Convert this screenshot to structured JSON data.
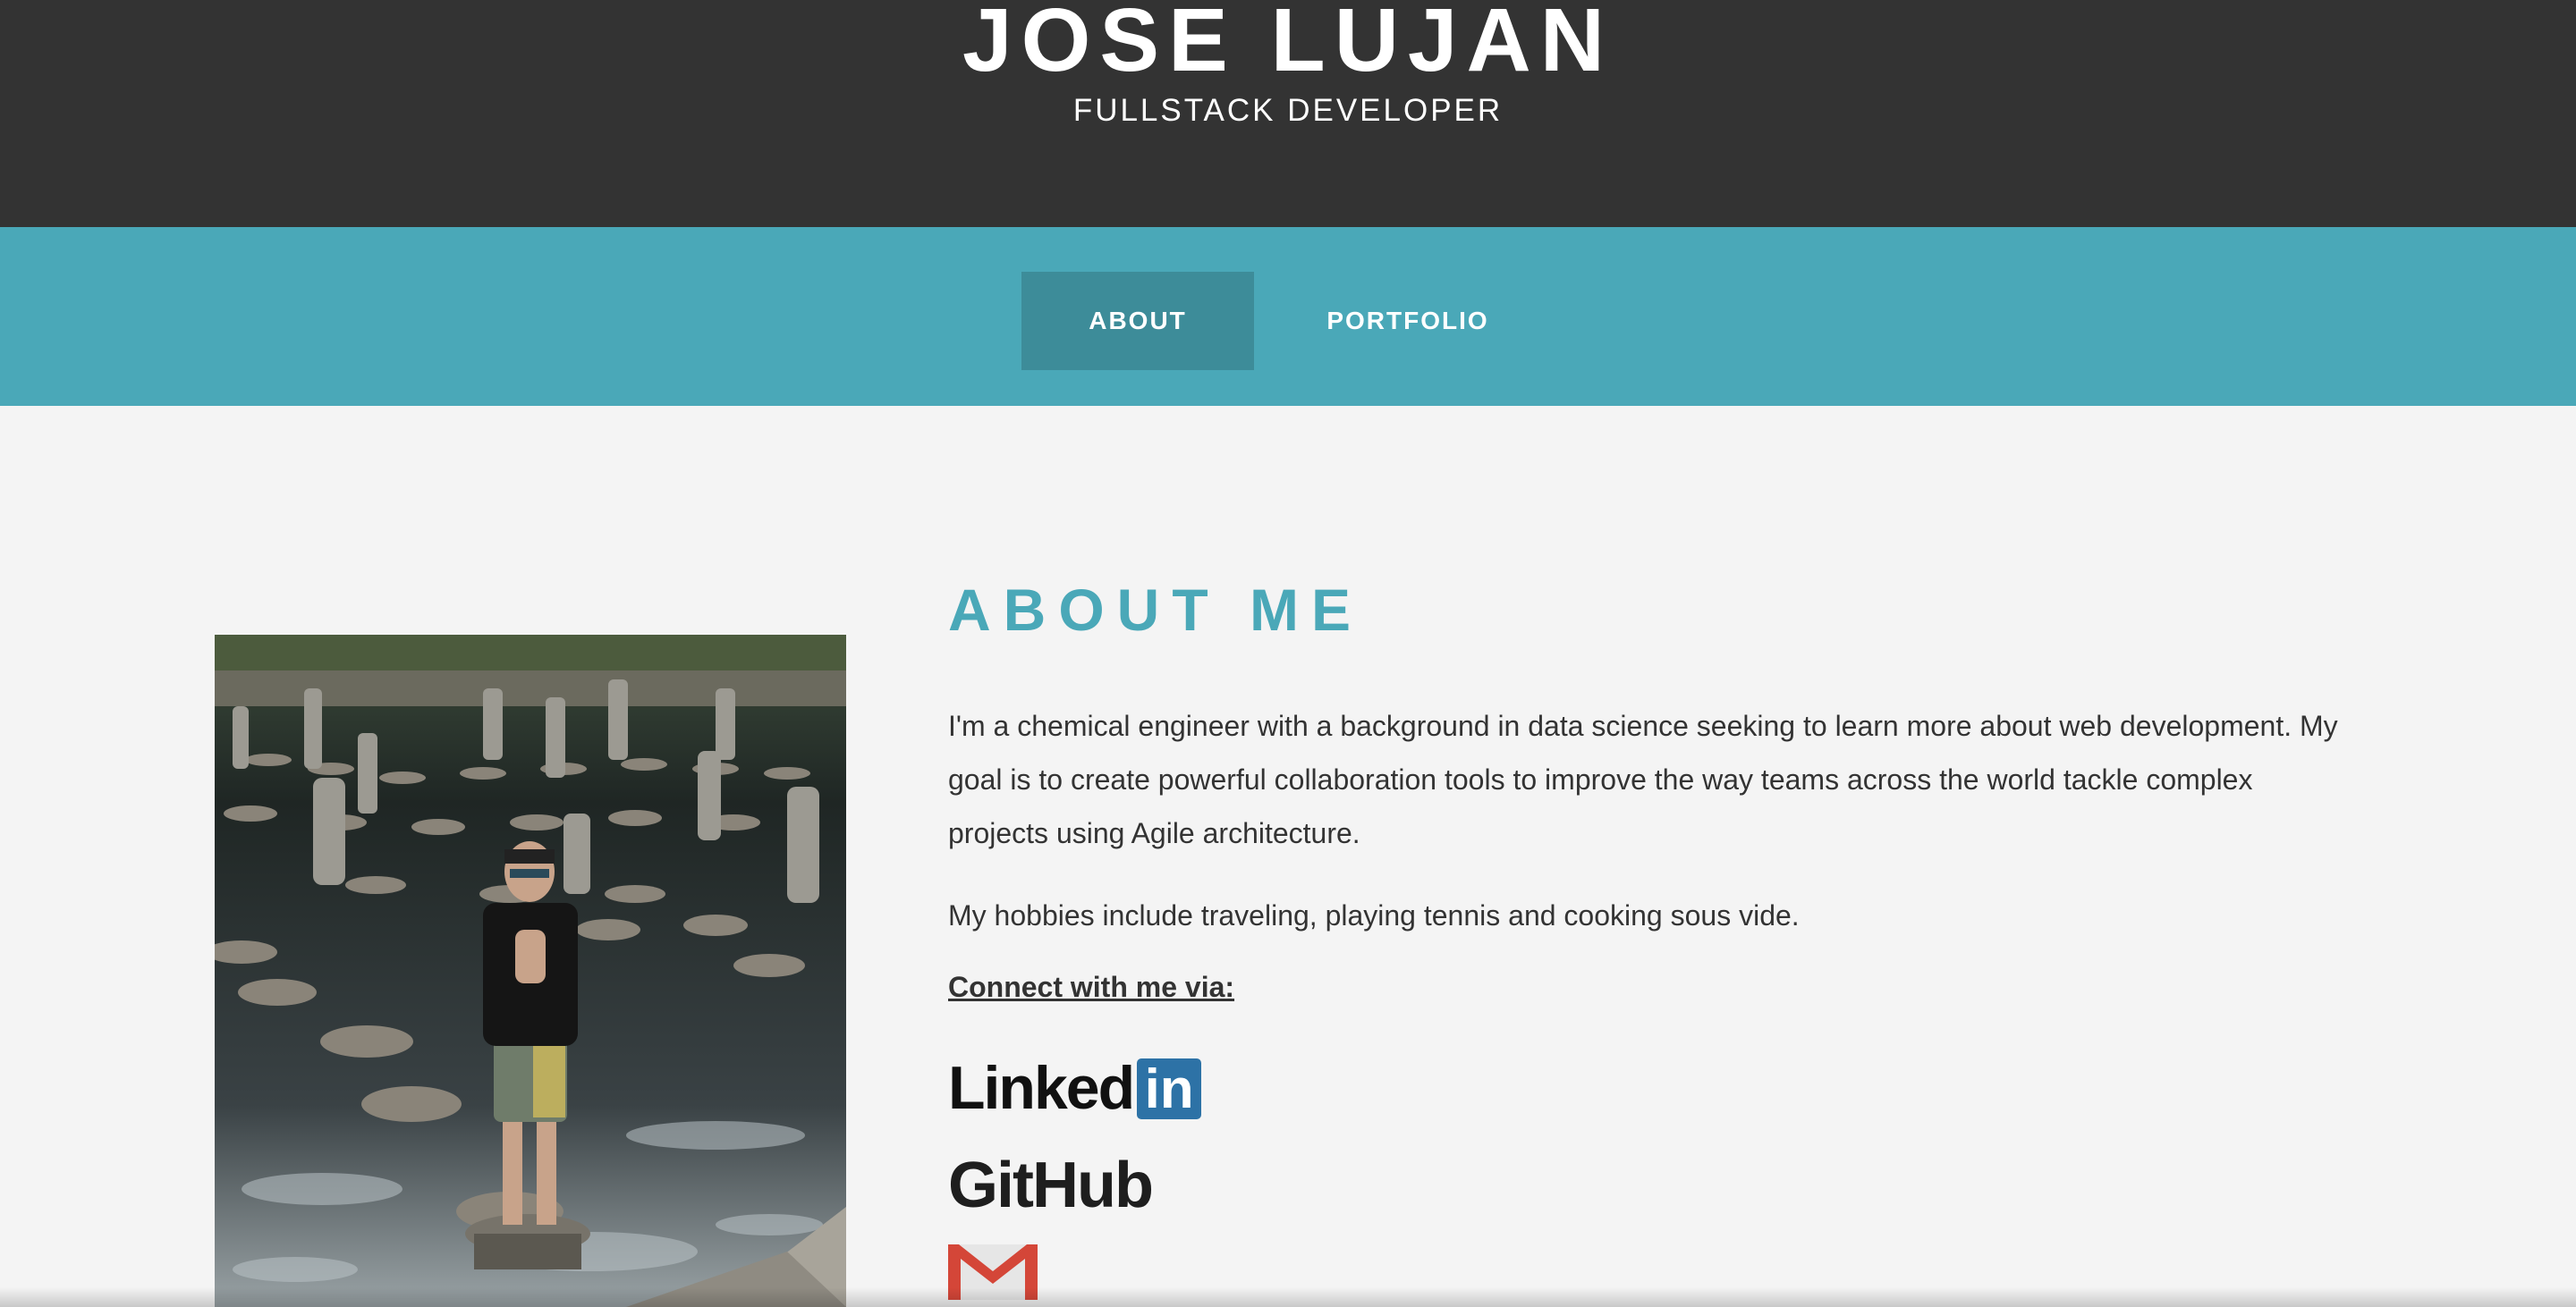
{
  "header": {
    "title": "JOSE LUJAN",
    "subtitle": "FULLSTACK DEVELOPER"
  },
  "nav": {
    "about": "ABOUT",
    "portfolio": "PORTFOLIO",
    "active": "ABOUT"
  },
  "about": {
    "heading": "ABOUT ME",
    "paragraph1": "I'm a chemical engineer with a background in data science seeking to learn more about web development. My goal is to create powerful collaboration tools to improve the way teams across the world tackle complex projects using Agile architecture.",
    "paragraph2": "My hobbies include traveling, playing tennis and cooking sous vide.",
    "connect_label": "Connect with me via:"
  },
  "social": {
    "linkedin_word": "Linked",
    "linkedin_in": "in",
    "github_word": "GitHub",
    "gmail_icon": "gmail-icon"
  },
  "colors": {
    "header_bg": "#333333",
    "nav_bg": "#4aa8b8",
    "nav_active_bg": "#3d8c99",
    "accent": "#4aa8b8",
    "linkedin": "#2d72a6",
    "gmail": "#d44638"
  }
}
